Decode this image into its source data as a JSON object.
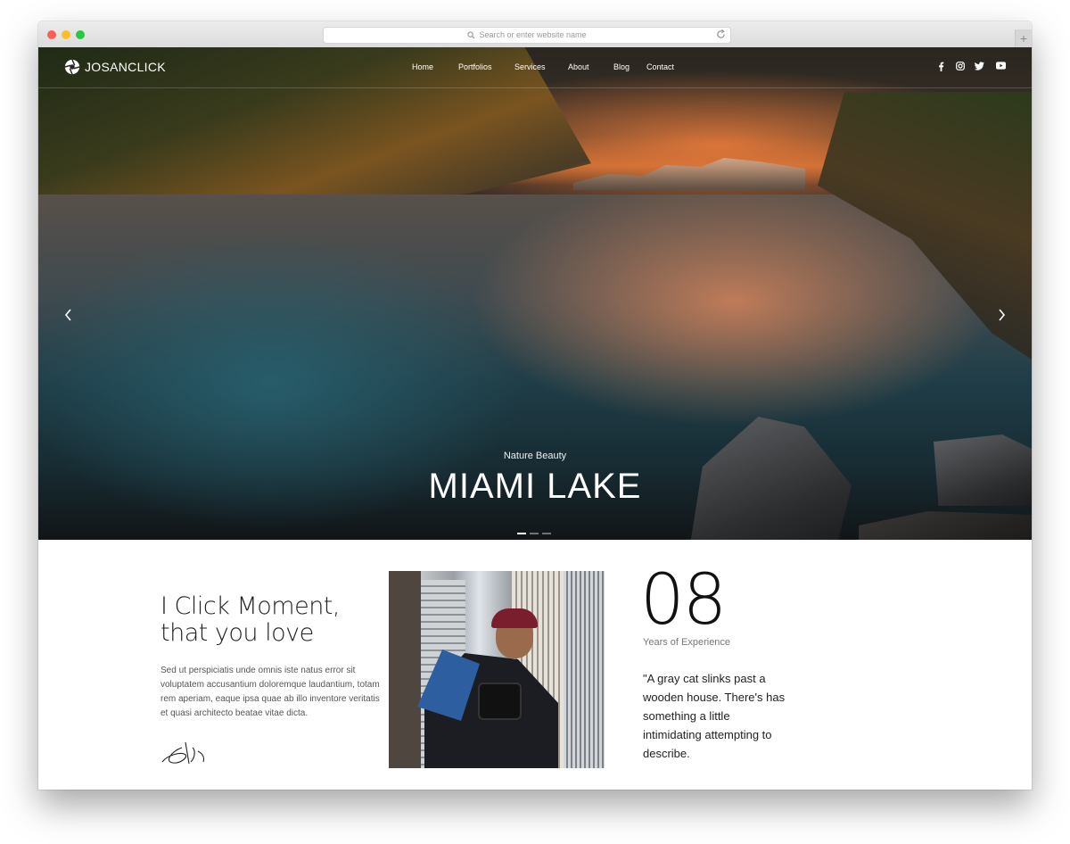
{
  "browser": {
    "url_placeholder": "Search or enter website name"
  },
  "site": {
    "logo_text": "JOSANCLICK",
    "nav": [
      "Home",
      "Portfolios",
      "Services",
      "About",
      "Blog",
      "Contact"
    ],
    "social_icons": [
      "facebook-icon",
      "instagram-icon",
      "twitter-icon",
      "youtube-icon"
    ]
  },
  "hero": {
    "subtitle": "Nature Beauty",
    "title": "MIAMI LAKE",
    "slide_count": 3,
    "active_slide": 1
  },
  "about": {
    "title": "I Click Moment,\nthat you love",
    "body": "Sed ut perspiciatis unde omnis iste natus error sit voluptatem accusantium doloremque laudantium, totam rem aperiam, eaque ipsa quae ab illo inventore veritatis et quasi architecto beatae vitae dicta.",
    "years_number": "08",
    "years_label": "Years of Experience",
    "quote": "\"A gray cat slinks past a wooden house. There's has something a little intimidating attempting to describe."
  },
  "colors": {
    "accent_sunset": "#e2783a",
    "text_dark": "#222222"
  }
}
